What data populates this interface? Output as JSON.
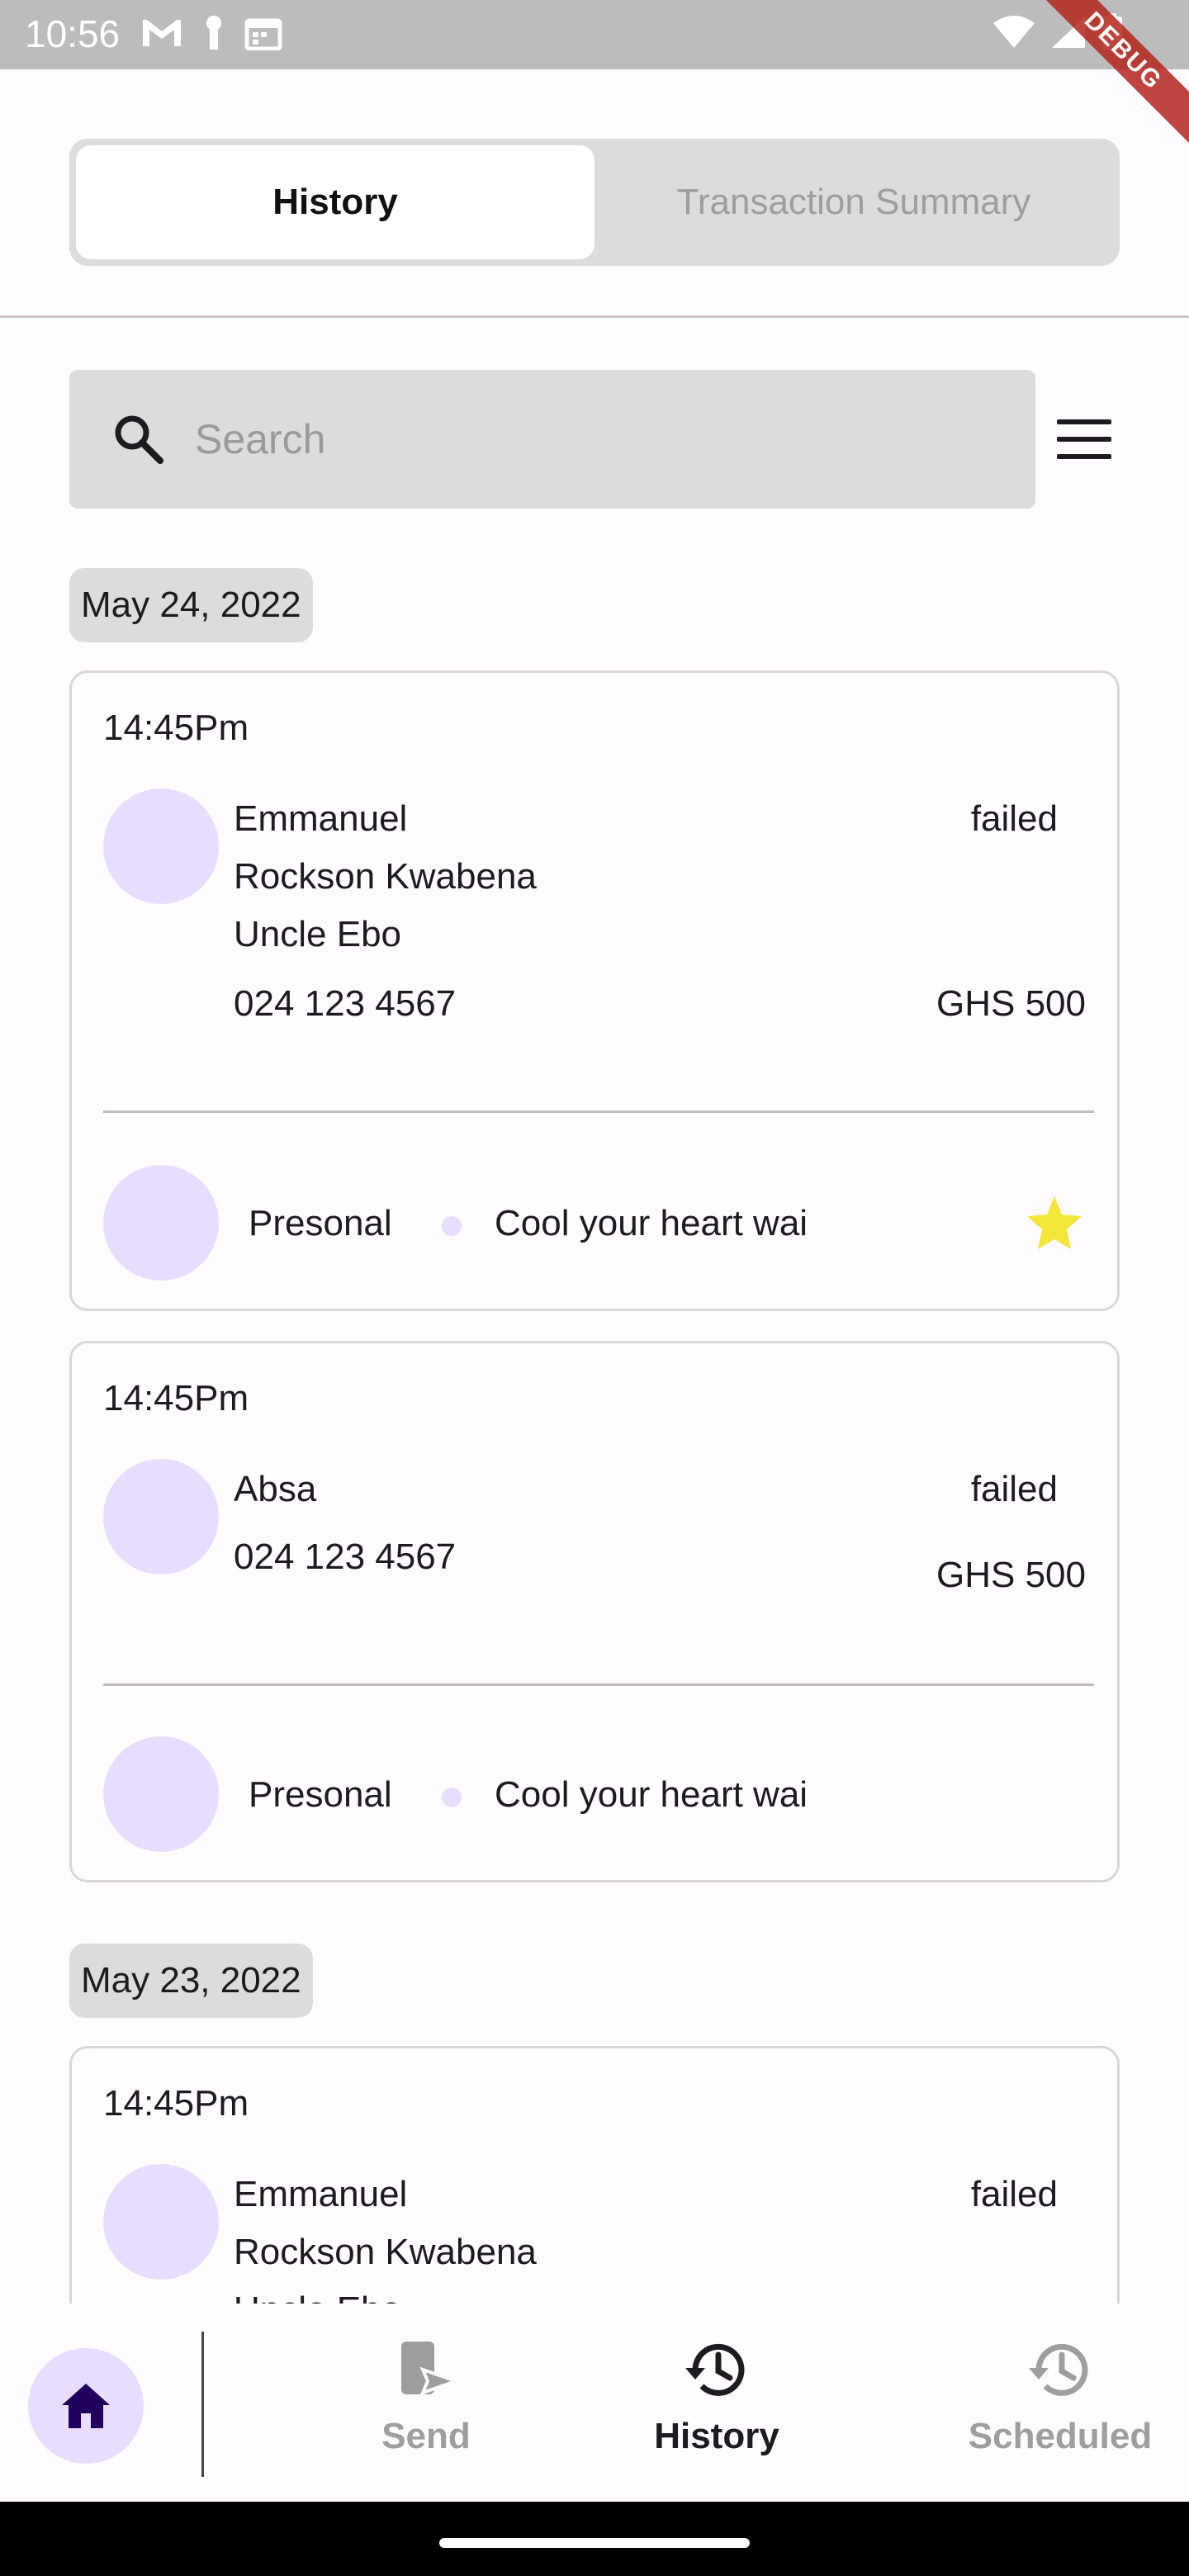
{
  "status_bar": {
    "time": "10:56",
    "debug_label": "DEBUG"
  },
  "tabs": [
    {
      "label": "History",
      "active": true
    },
    {
      "label": "Transaction Summary",
      "active": false
    }
  ],
  "search": {
    "placeholder": "Search"
  },
  "groups": [
    {
      "date": "May 24, 2022",
      "transactions": [
        {
          "time": "14:45Pm",
          "name_lines": [
            "Emmanuel",
            "Rockson Kwabena",
            "Uncle Ebo"
          ],
          "phone": "024 123 4567",
          "status": "failed",
          "amount": "GHS 500",
          "category": "Presonal",
          "note": "Cool your heart wai",
          "starred": true
        },
        {
          "time": "14:45Pm",
          "name_lines": [
            "Absa"
          ],
          "phone": "024 123 4567",
          "status": "failed",
          "amount": "GHS 500",
          "category": "Presonal",
          "note": "Cool your heart wai",
          "starred": false
        }
      ]
    },
    {
      "date": "May 23, 2022",
      "transactions": [
        {
          "time": "14:45Pm",
          "name_lines": [
            "Emmanuel",
            "Rockson Kwabena",
            "Uncle Ebo"
          ],
          "status": "failed"
        }
      ]
    }
  ],
  "bottom_nav": {
    "home_icon": "home-icon",
    "items": [
      {
        "label": "Send",
        "icon": "send-icon",
        "active": false
      },
      {
        "label": "History",
        "icon": "history-icon",
        "active": true
      },
      {
        "label": "Scheduled",
        "icon": "scheduled-icon",
        "active": false
      }
    ]
  },
  "colors": {
    "accent_light": "#e8ddff",
    "home_icon": "#21005d",
    "star": "#f5e63a"
  }
}
